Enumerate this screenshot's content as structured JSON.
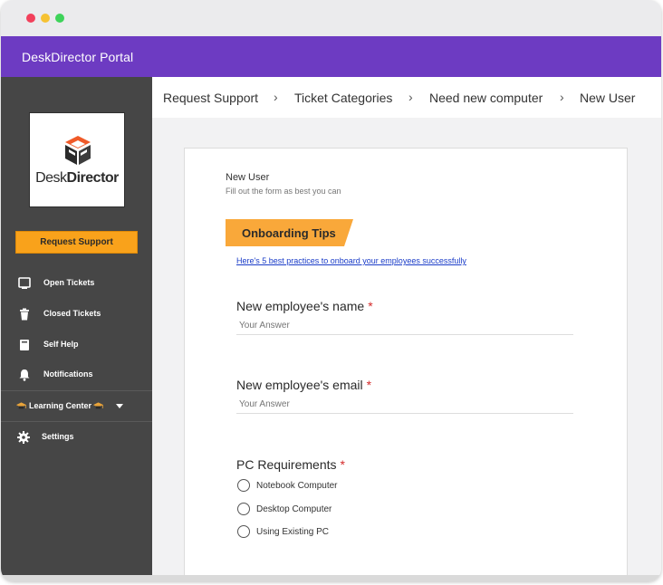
{
  "app": {
    "title": "DeskDirector Portal",
    "logo_text_light": "Desk",
    "logo_text_bold": "Director",
    "brand_color": "#6d3bc2",
    "accent_color": "#f9a21b"
  },
  "sidebar": {
    "request_button": "Request Support",
    "items": [
      {
        "label": "Open Tickets",
        "icon": "monitor-icon"
      },
      {
        "label": "Closed Tickets",
        "icon": "trash-icon"
      },
      {
        "label": "Self Help",
        "icon": "book-icon"
      },
      {
        "label": "Notifications",
        "icon": "bell-icon"
      },
      {
        "label": "Learning Center",
        "icon": "graduation-cap-icon"
      },
      {
        "label": "Settings",
        "icon": "gear-icon"
      }
    ]
  },
  "breadcrumb": {
    "items": [
      "Request Support",
      "Ticket Categories",
      "Need new computer",
      "New User"
    ],
    "separator": "›"
  },
  "form": {
    "title": "New User",
    "subtitle": "Fill out the form as best you can",
    "banner": "Onboarding Tips",
    "link": "Here's 5 best practices to onboard your employees successfully",
    "questions": [
      {
        "label": "New employee's name",
        "required": "*",
        "placeholder": "Your Answer"
      },
      {
        "label": "New employee's email",
        "required": "*",
        "placeholder": "Your Answer"
      },
      {
        "label": "PC Requirements",
        "required": "*",
        "options": [
          "Notebook Computer",
          "Desktop Computer",
          "Using Existing PC"
        ]
      }
    ]
  }
}
